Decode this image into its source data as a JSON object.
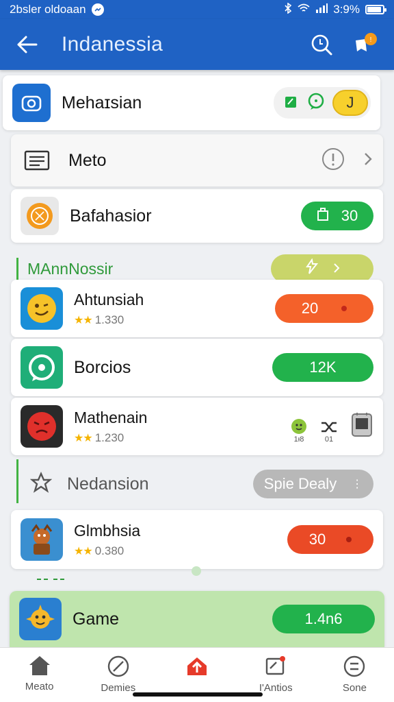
{
  "status": {
    "left_text": "2bsler oldoaan",
    "right_text": "3:9%",
    "battery_level": 0.9
  },
  "appbar": {
    "title": "Indanessia"
  },
  "rows": {
    "mahasian": {
      "label": "Mehaɪsian",
      "badge": "J"
    },
    "meto": {
      "label": "Meto"
    },
    "bafahasior": {
      "label": "Bafahasior",
      "pill": "30"
    },
    "section1": {
      "label": "MAnnNossir"
    },
    "ahtunsiah": {
      "name": "Ahtunsiah",
      "rating": "1.330",
      "pill": "20"
    },
    "borcios": {
      "label": "Borcios",
      "pill": "12K"
    },
    "mathenain": {
      "name": "Mathenain",
      "rating": "1.230",
      "mini1": "1ᵼ8",
      "mini2": "01"
    },
    "section2": {
      "label": "Nedansion",
      "pill": "Spie Dealy"
    },
    "glmbhsia": {
      "name": "Glmbhsia",
      "rating": "0.380",
      "pill": "30"
    },
    "game": {
      "label": "Game",
      "pill": "1.4n6"
    }
  },
  "nav": [
    "Meato",
    "Demies",
    "",
    "I'Antios",
    "Sone"
  ],
  "colors": {
    "primary": "#1f62c4",
    "green": "#22b24c",
    "orange": "#f4612a",
    "yellow": "#f7d02c"
  }
}
